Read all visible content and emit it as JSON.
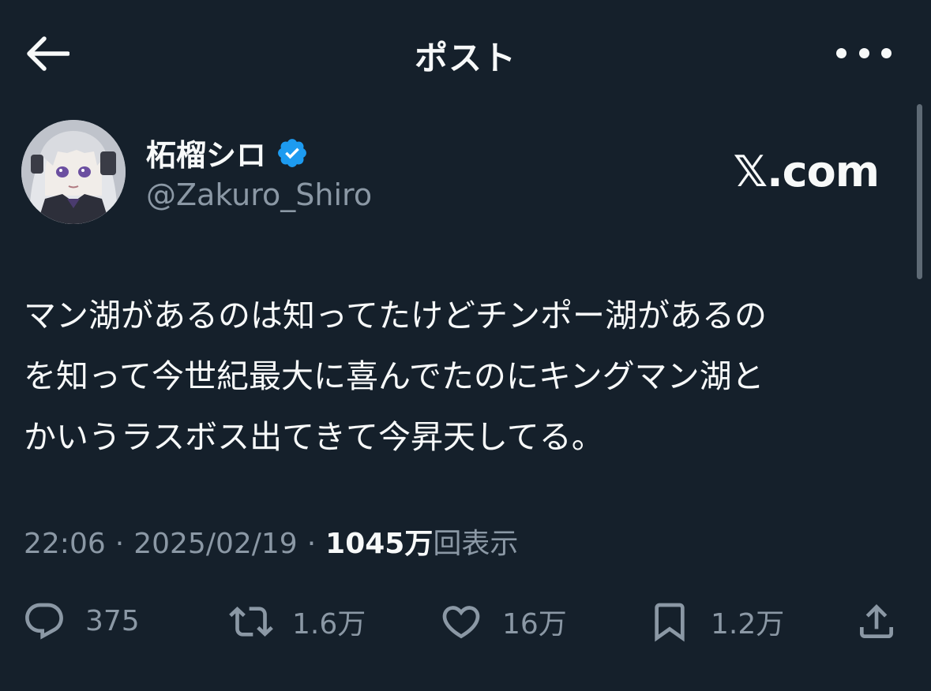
{
  "header": {
    "title": "ポスト",
    "back_icon": "arrow-left-icon",
    "more_icon": "more-horizontal-icon"
  },
  "author": {
    "name": "柘榴シロ",
    "handle": "@Zakuro_Shiro",
    "verified": true,
    "verified_color": "#1d9bf0"
  },
  "site_label": "𝕏.com",
  "tweet": {
    "lines": [
      "マン湖があるのは知ってたけどチンポー湖があるの",
      "を知って今世紀最大に喜んでたのにキングマン湖と",
      "かいうラスボス出てきて今昇天してる。"
    ]
  },
  "meta": {
    "time": "22:06",
    "separator": "·",
    "date": "2025/02/19",
    "views_count": "1045万",
    "views_suffix": "回表示"
  },
  "actions": {
    "reply": {
      "icon": "reply-icon",
      "count": "375"
    },
    "retweet": {
      "icon": "retweet-icon",
      "count": "1.6万"
    },
    "like": {
      "icon": "heart-icon",
      "count": "16万"
    },
    "bookmark": {
      "icon": "bookmark-icon",
      "count": "1.2万"
    },
    "share": {
      "icon": "share-icon"
    }
  },
  "colors": {
    "background": "#15202b",
    "text_primary": "#f7f9f9",
    "text_secondary": "#8b98a5",
    "accent": "#1d9bf0"
  }
}
